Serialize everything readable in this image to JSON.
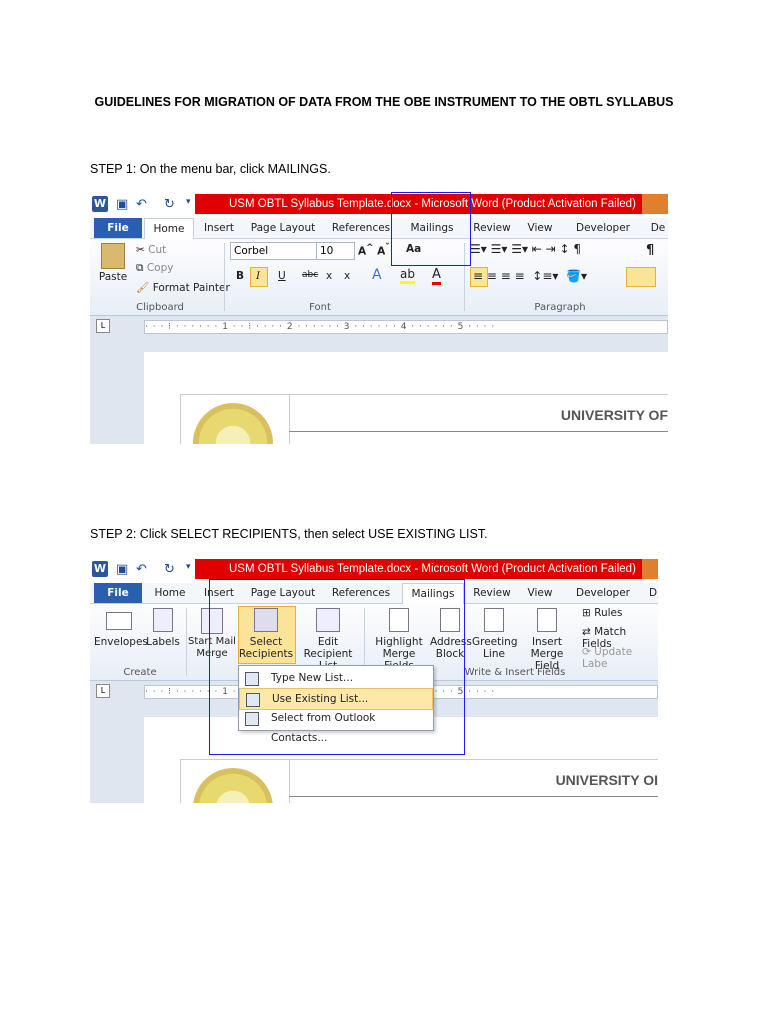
{
  "doc": {
    "title": "GUIDELINES FOR MIGRATION OF DATA FROM THE OBE INSTRUMENT TO THE OBTL SYLLABUS",
    "step1": "STEP 1: On the menu bar, click MAILINGS.",
    "step2": "STEP 2: Click SELECT RECIPIENTS, then select USE EXISTING LIST."
  },
  "window": {
    "title": "USM OBTL Syllabus Template.docx  -  Microsoft Word (Product Activation Failed)",
    "app_icon": "W"
  },
  "tabs1": [
    "File",
    "Home",
    "Insert",
    "Page Layout",
    "References",
    "Mailings",
    "Review",
    "View",
    "Developer",
    "De"
  ],
  "tabs2": [
    "File",
    "Home",
    "Insert",
    "Page Layout",
    "References",
    "Mailings",
    "Review",
    "View",
    "Developer",
    "D"
  ],
  "home_ribbon": {
    "paste": "Paste",
    "cut": "Cut",
    "copy": "Copy",
    "format_painter": "Format Painter",
    "clipboard": "Clipboard",
    "font_name": "Corbel",
    "font_size": "10",
    "font": "Font",
    "paragraph": "Paragraph",
    "bold": "B",
    "italic": "I",
    "underline": "U",
    "strike": "abc",
    "sub": "x",
    "sup": "x",
    "aa": "Aa",
    "pilcrow": "¶"
  },
  "mailings_ribbon": {
    "envelopes": "Envelopes",
    "labels": "Labels",
    "create": "Create",
    "start_mail_merge": "Start Mail Merge",
    "select_recipients_1": "Select",
    "select_recipients_2": "Recipients",
    "edit_list_1": "Edit",
    "edit_list_2": "Recipient List",
    "highlight_1": "Highlight",
    "highlight_2": "Merge Fields",
    "address_1": "Address",
    "address_2": "Block",
    "greeting_1": "Greeting",
    "greeting_2": "Line",
    "insert_merge_1": "Insert Merge",
    "insert_merge_2": "Field",
    "write_insert": "Write & Insert Fields",
    "rules": "Rules",
    "match_fields": "Match Fields",
    "update_labels": "Update Labe"
  },
  "dropdown": {
    "items": [
      "Type New List...",
      "Use Existing List...",
      "Select from Outlook Contacts..."
    ]
  },
  "ruler_text": "· · · ⁝ · · · · · · 1 · · ⁝ · · · · 2 · · · · · · 3 · · · · · · 4 · · · · · · 5 · · · ·",
  "ruler_box": "L",
  "page": {
    "university": "UNIVERSITY OF",
    "university2": "UNIVERSITY OI"
  }
}
